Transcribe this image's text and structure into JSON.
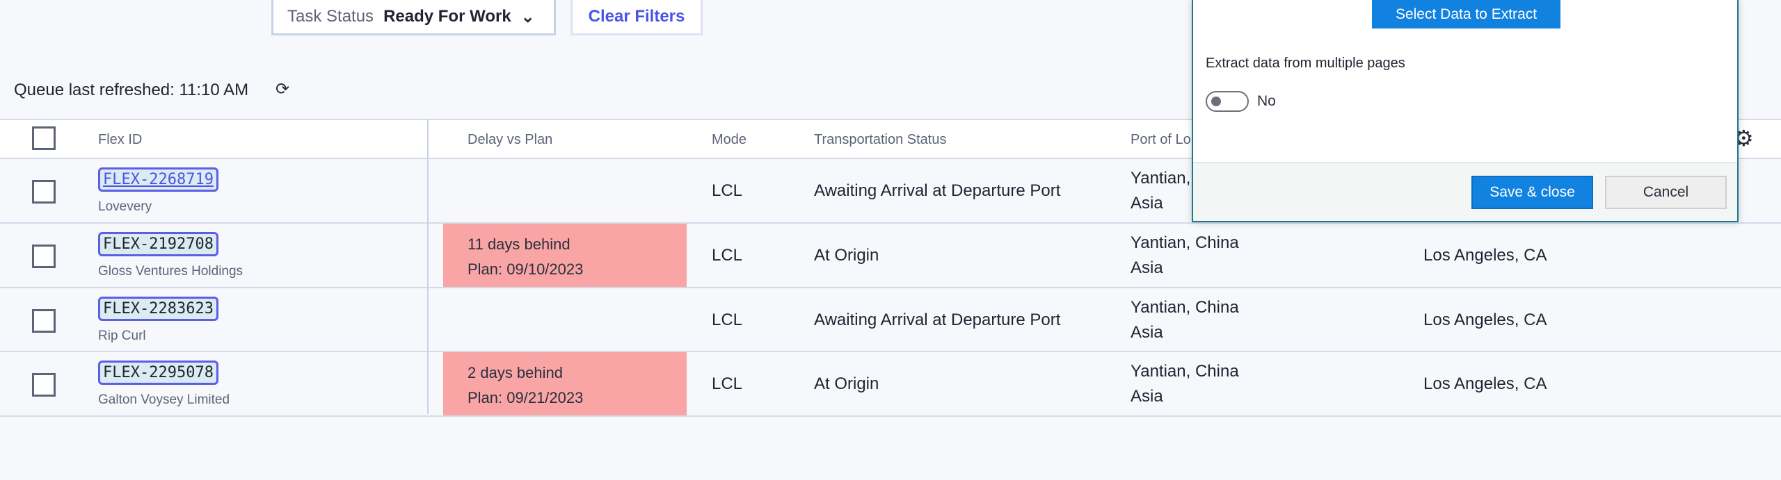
{
  "filters": {
    "task_status_label": "Task Status",
    "task_status_value": "Ready For Work",
    "clear_label": "Clear Filters"
  },
  "queue": {
    "refreshed": "Queue last refreshed: 11:10 AM"
  },
  "table": {
    "headers": {
      "flex_id": "Flex ID",
      "delay": "Delay vs Plan",
      "mode": "Mode",
      "transport": "Transportation Status",
      "port": "Port of Lo"
    },
    "rows": [
      {
        "id": "FLEX-2268719",
        "company": "Lovevery",
        "delay": "",
        "plan": "",
        "mode": "LCL",
        "status": "Awaiting Arrival at Departure Port",
        "port": "Yantian,",
        "region": "Asia",
        "dest": ""
      },
      {
        "id": "FLEX-2192708",
        "company": "Gloss Ventures Holdings",
        "delay": "11 days behind",
        "plan": "Plan: 09/10/2023",
        "mode": "LCL",
        "status": "At Origin",
        "port": "Yantian, China",
        "region": "Asia",
        "dest": "Los Angeles, CA"
      },
      {
        "id": "FLEX-2283623",
        "company": "Rip Curl",
        "delay": "",
        "plan": "",
        "mode": "LCL",
        "status": "Awaiting Arrival at Departure Port",
        "port": "Yantian, China",
        "region": "Asia",
        "dest": "Los Angeles, CA"
      },
      {
        "id": "FLEX-2295078",
        "company": "Galton Voysey Limited",
        "delay": "2 days behind",
        "plan": "Plan: 09/21/2023",
        "mode": "LCL",
        "status": "At Origin",
        "port": "Yantian, China",
        "region": "Asia",
        "dest": "Los Angeles, CA"
      }
    ]
  },
  "modal": {
    "select_label": "Select Data to Extract",
    "multi_label": "Extract data from multiple pages",
    "toggle_value": "No",
    "save_label": "Save & close",
    "cancel_label": "Cancel"
  }
}
